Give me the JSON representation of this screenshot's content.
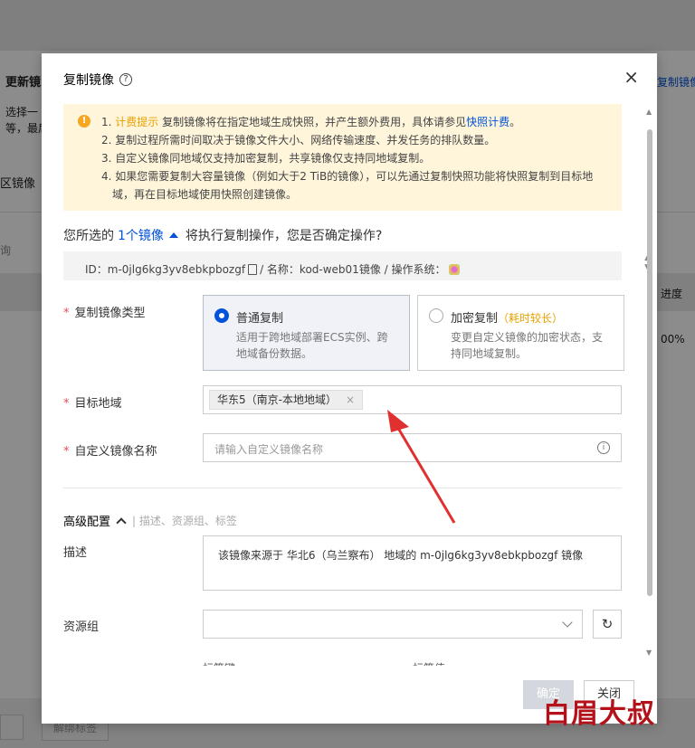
{
  "background": {
    "heading": "更新镜",
    "desc_line1": "选择一",
    "desc_line2": "等，最后",
    "section_label": "区镜像",
    "search_hint": "询",
    "right_link": "复制镜像",
    "col_progress": "进度",
    "progress_value": "00%",
    "bottom_button": "解绑标签"
  },
  "dialog": {
    "title": "复制镜像",
    "help_icon": "?",
    "close_icon": "×",
    "notice": {
      "icon": "!",
      "line1_prefix": "1. ",
      "line1_highlight": "计费提示",
      "line1_text": " 复制镜像将在指定地域生成快照，并产生额外费用，具体请参见",
      "line1_link": "快照计费",
      "line1_suffix": "。",
      "line2": "2. 复制过程所需时间取决于镜像文件大小、网络传输速度、并发任务的排队数量。",
      "line3": "3. 自定义镜像同地域仅支持加密复制，共享镜像仅支持同地域复制。",
      "line4": "4. 如果您需要复制大容量镜像（例如大于2 TiB的镜像），可以先通过复制快照功能将快照复制到目标地",
      "line5": "域，再在目标地域使用快照创建镜像。"
    },
    "confirm": {
      "prefix": "您所选的",
      "link": "1个镜像",
      "suffix": "将执行复制操作，您是否确定操作?"
    },
    "idbar": {
      "id_text": "ID：m-0jlg6kg3yv8ebkpbozgf",
      "name_text": "/ 名称：kod-web01镜像 / 操作系统："
    },
    "form": {
      "copy_type_label": "复制镜像类型",
      "normal_title": "普通复制",
      "normal_desc": "适用于跨地域部署ECS实例、跨地域备份数据。",
      "encrypted_title": "加密复制",
      "encrypted_note": "（耗时较长）",
      "encrypted_desc": "变更自定义镜像的加密状态，支持同地域复制。",
      "region_label": "目标地域",
      "region_tag": "华东5（南京-本地地域）",
      "name_label": "自定义镜像名称",
      "name_placeholder": "请输入自定义镜像名称",
      "required_mark": "*"
    },
    "advanced": {
      "title": "高级配置",
      "subtitle": "| 描述、资源组、标签",
      "desc_label": "描述",
      "desc_value": "该镜像来源于 华北6（乌兰察布） 地域的 m-0jlg6kg3yv8ebkpbozgf 镜像",
      "rg_label": "资源组",
      "tag_key_label": "标签键",
      "tag_value_label": "标签值"
    },
    "footer": {
      "confirm": "确定",
      "close": "关闭"
    }
  },
  "watermark": "白眉大叔",
  "colors": {
    "primary": "#0052d9",
    "warning": "#f5a623",
    "notice_bg": "#fff5db",
    "required": "#e34d59",
    "annotation_arrow": "#e03030",
    "watermark": "#b3121a"
  }
}
